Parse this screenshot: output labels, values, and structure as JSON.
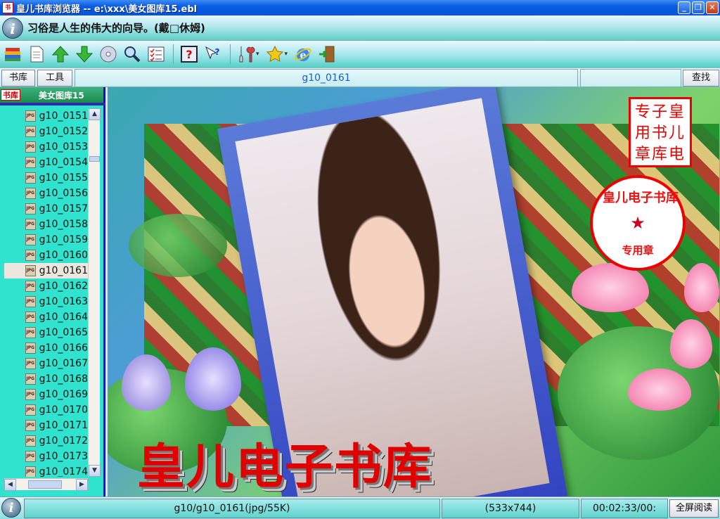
{
  "window": {
    "app_icon_text": "书吧",
    "title": "皇儿书库浏览器 -- e:\\xxx\\美女图库15.ebl",
    "min_glyph": "_",
    "max_glyph": "❐",
    "close_glyph": "✕"
  },
  "quote_bar": {
    "info_icon_glyph": "i",
    "quote": "习俗是人生的伟大的向导。(戴□休姆)"
  },
  "toolbar": {
    "icons": [
      "books-icon",
      "document-icon",
      "arrow-up-icon",
      "arrow-down-icon",
      "cd-icon",
      "magnifier-icon",
      "checklist-icon",
      "help-icon",
      "help-pointer-icon",
      "tools-icon",
      "favorites-star-icon",
      "internet-explorer-icon",
      "exit-door-icon"
    ],
    "dropdown_glyph": "▾"
  },
  "navbar": {
    "library_button": "书库",
    "tools_button": "工具",
    "current_title": "g10_0161",
    "search_value": "",
    "search_button": "查找"
  },
  "left_pane": {
    "tab_label": "书库",
    "header_title": "美女图库15",
    "file_icon_text": "JPG",
    "items": [
      {
        "label": "g10_0151"
      },
      {
        "label": "g10_0152"
      },
      {
        "label": "g10_0153"
      },
      {
        "label": "g10_0154"
      },
      {
        "label": "g10_0155"
      },
      {
        "label": "g10_0156"
      },
      {
        "label": "g10_0157"
      },
      {
        "label": "g10_0158"
      },
      {
        "label": "g10_0159"
      },
      {
        "label": "g10_0160"
      },
      {
        "label": "g10_0161"
      },
      {
        "label": "g10_0162"
      },
      {
        "label": "g10_0163"
      },
      {
        "label": "g10_0164"
      },
      {
        "label": "g10_0165"
      },
      {
        "label": "g10_0166"
      },
      {
        "label": "g10_0167"
      },
      {
        "label": "g10_0168"
      },
      {
        "label": "g10_0169"
      },
      {
        "label": "g10_0170"
      },
      {
        "label": "g10_0171"
      },
      {
        "label": "g10_0172"
      },
      {
        "label": "g10_0173"
      },
      {
        "label": "g10_0174"
      }
    ],
    "selected_index": 10,
    "scroll_up_glyph": "▲",
    "scroll_down_glyph": "▼",
    "scroll_left_glyph": "◀",
    "scroll_right_glyph": "▶"
  },
  "content": {
    "stamp_square_lines": [
      "专子皇",
      "用书儿",
      "章库电"
    ],
    "stamp_circle_text": "皇儿电子书库",
    "stamp_circle_star": "★",
    "stamp_circle_sub": "专用章",
    "banner_text": "皇儿电子书库"
  },
  "statusbar": {
    "info_icon_glyph": "i",
    "file_info": "g10/g10_0161(jpg/55K)",
    "dimensions": "(533x744)",
    "time": "00:02:33/00:",
    "fullscreen_button": "全屏阅读"
  },
  "colors": {
    "title_blue": "#0a5ce6",
    "teal_bar": "#5fd0c8",
    "list_bg": "#2fe3cf",
    "accent_red": "#e00000"
  }
}
